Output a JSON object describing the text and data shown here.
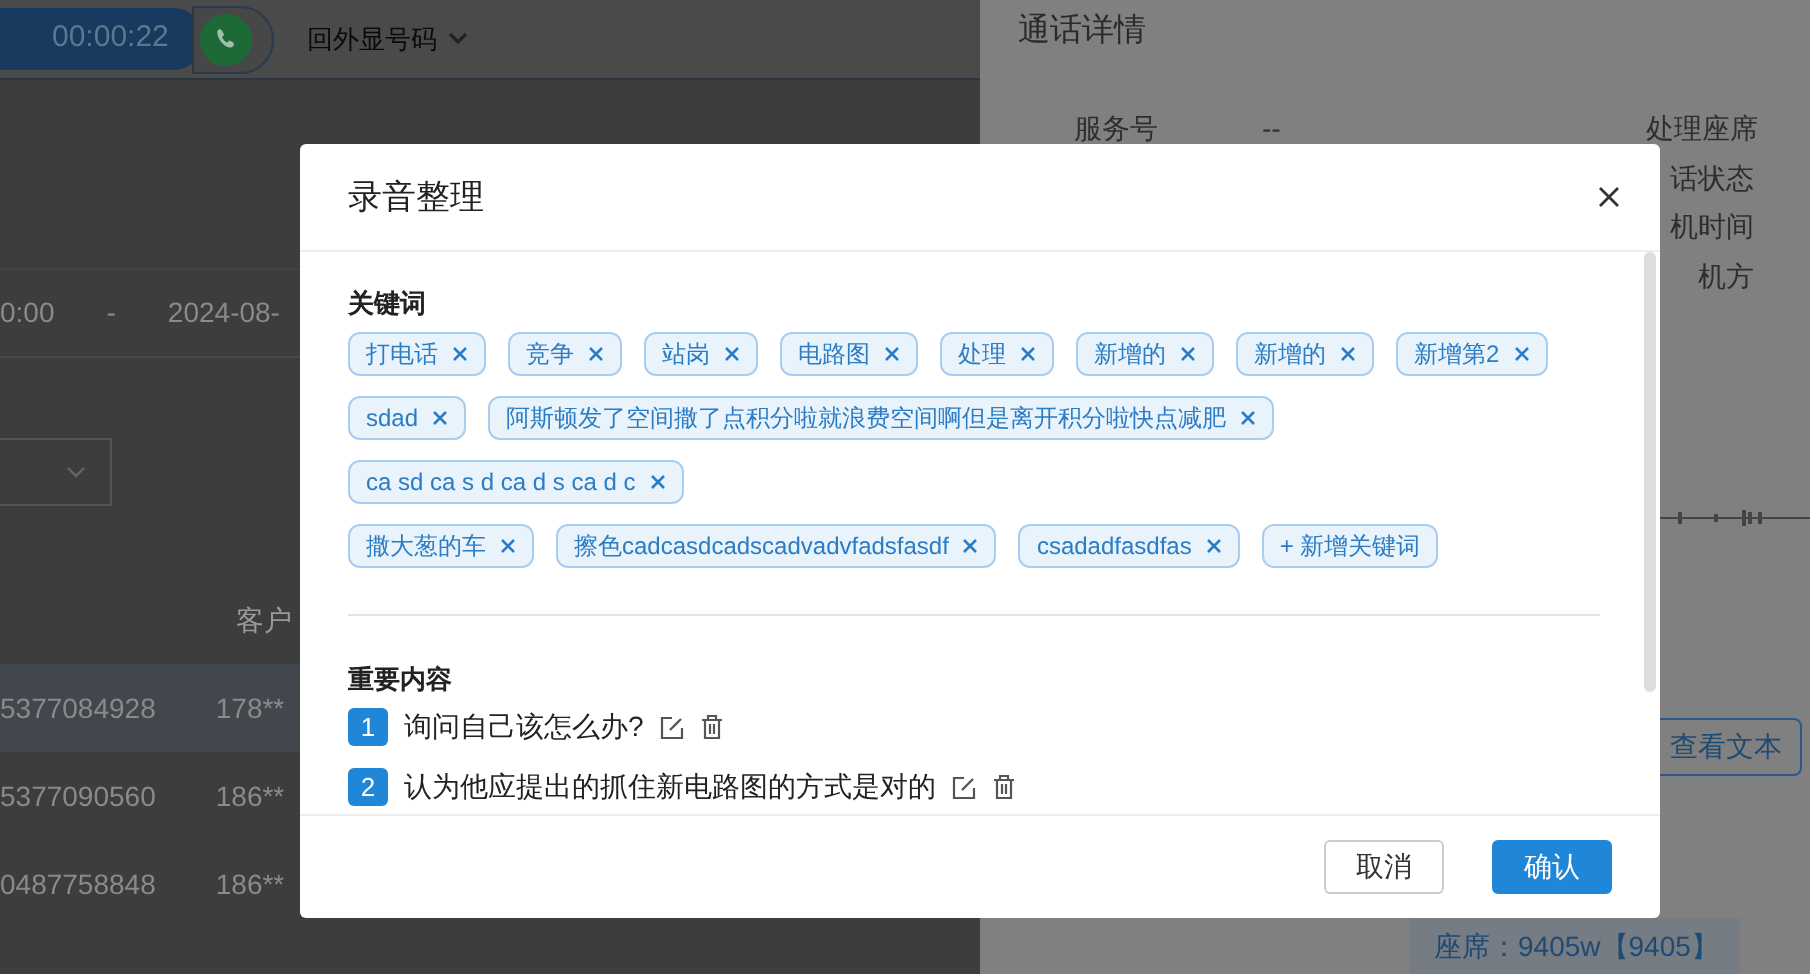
{
  "top_bar": {
    "timer": "00:00:22",
    "caller_id_select": "回外显号码"
  },
  "list_page": {
    "date_range": {
      "start": "0:00",
      "separator": "-",
      "end": "2024-08-"
    },
    "column_header": "客户",
    "rows": [
      {
        "column_1": "5377084928",
        "column_2": "178**",
        "selected": true
      },
      {
        "column_1": "5377090560",
        "column_2": "186**",
        "selected": false
      },
      {
        "column_1": "0487758848",
        "column_2": "186**",
        "selected": false
      }
    ]
  },
  "detail_drawer": {
    "title": "通话详情",
    "fields_left": [
      {
        "label": "服务号",
        "value": "--"
      }
    ],
    "fields_right": [
      {
        "label": "处理座席"
      },
      {
        "label": "话状态"
      },
      {
        "label": "机时间"
      },
      {
        "label": "机方"
      }
    ],
    "view_text_button": "查看文本",
    "seat": "座席：9405w【9405】"
  },
  "modal": {
    "title": "录音整理",
    "keywords": {
      "heading": "关键词",
      "tag_groups": [
        [
          "打电话",
          "竞争",
          "站岗",
          "电路图",
          "处理",
          "新增的",
          "新增的",
          "新增第2",
          "sdad",
          "阿斯顿发了空间撒了点积分啦就浪费空间啊但是离开积分啦快点减肥",
          "ca sd ca s d ca d s ca d c"
        ],
        [
          "撒大葱的车",
          "擦色cadcasdcadscadvadvfadsfasdf",
          "csadadfasdfas"
        ]
      ],
      "add_button": "+ 新增关键词"
    },
    "important": {
      "heading": "重要内容",
      "items": [
        {
          "number": "1",
          "text": "询问自己该怎么办?"
        },
        {
          "number": "2",
          "text": "认为他应提出的抓住新电路图的方式是对的"
        }
      ]
    },
    "buttons": {
      "cancel": "取消",
      "confirm": "确认"
    }
  }
}
